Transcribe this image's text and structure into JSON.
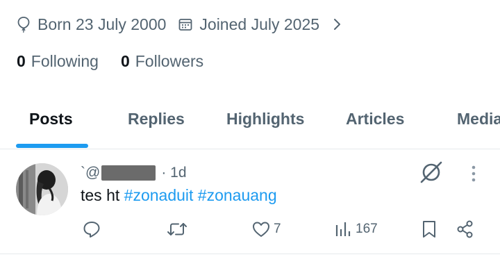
{
  "profile": {
    "born": "Born 23 July 2000",
    "joined": "Joined July 2025",
    "following_count": "0",
    "following_label": "Following",
    "followers_count": "0",
    "followers_label": "Followers"
  },
  "tabs": [
    {
      "label": "Posts",
      "active": true
    },
    {
      "label": "Replies",
      "active": false
    },
    {
      "label": "Highlights",
      "active": false
    },
    {
      "label": "Articles",
      "active": false
    },
    {
      "label": "Media",
      "active": false
    }
  ],
  "post": {
    "handle_prefix": "`@",
    "time": "· 1d",
    "text": "tes ht ",
    "hashtags": [
      "#zonaduit",
      "#zonauang"
    ],
    "likes": "7",
    "views": "167"
  },
  "icons": {
    "born": "balloon-icon",
    "joined": "calendar-icon",
    "more_info": "chevron-right-icon",
    "grok": "grok-icon",
    "more": "more-vertical-icon",
    "reply": "reply-icon",
    "repost": "repost-icon",
    "like": "heart-icon",
    "views": "analytics-icon",
    "bookmark": "bookmark-icon",
    "share": "share-icon"
  },
  "colors": {
    "accent": "#1d9bf0",
    "text_primary": "#0f1419",
    "text_secondary": "#536471",
    "divider": "#e6e9ec"
  }
}
